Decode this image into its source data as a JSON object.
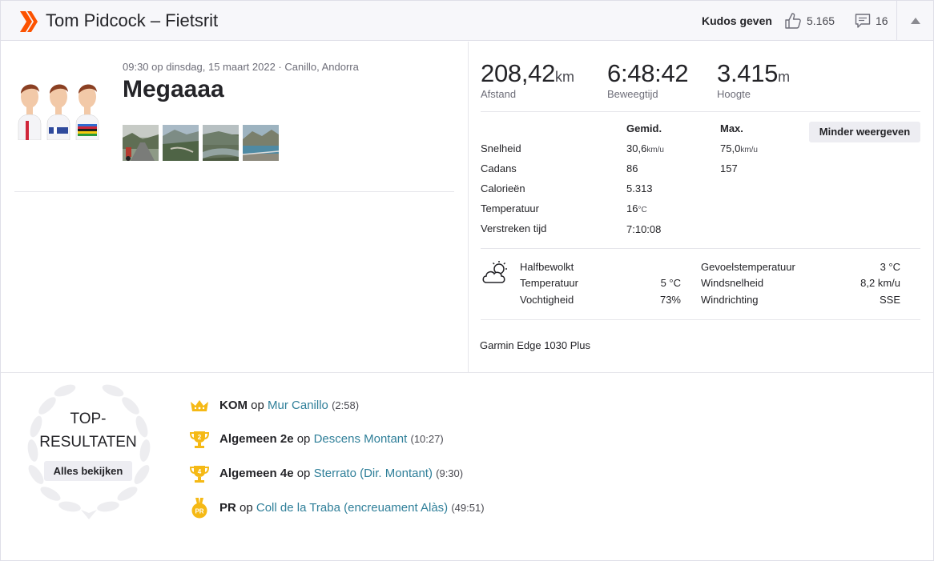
{
  "header": {
    "title": "Tom Pidcock – Fietsrit",
    "kudos_button": "Kudos geven",
    "kudos_count": "5.165",
    "comment_count": "16"
  },
  "activity": {
    "meta": "09:30 op dinsdag, 15 maart 2022 · Canillo, Andorra",
    "title": "Megaaaa"
  },
  "stats": {
    "distance": {
      "value": "208,42",
      "unit": "km",
      "label": "Afstand"
    },
    "moving_time": {
      "value": "6:48:42",
      "label": "Beweegtijd"
    },
    "elevation": {
      "value": "3.415",
      "unit": "m",
      "label": "Hoogte"
    }
  },
  "table": {
    "col_avg": "Gemid.",
    "col_max": "Max.",
    "less_button": "Minder weergeven",
    "rows": [
      {
        "label": "Snelheid",
        "avg": "30,6",
        "avg_unit": "km/u",
        "max": "75,0",
        "max_unit": "km/u"
      },
      {
        "label": "Cadans",
        "avg": "86",
        "avg_unit": "",
        "max": "157",
        "max_unit": ""
      },
      {
        "label": "Calorieën",
        "avg": "5.313",
        "avg_unit": "",
        "max": "",
        "max_unit": ""
      },
      {
        "label": "Temperatuur",
        "avg": "16",
        "avg_unit": "°C",
        "max": "",
        "max_unit": ""
      },
      {
        "label": "Verstreken tijd",
        "avg": "7:10:08",
        "avg_unit": "",
        "max": "",
        "max_unit": ""
      }
    ]
  },
  "weather": {
    "condition": "Halfbewolkt",
    "temp_label": "Temperatuur",
    "temp_value": "5 °C",
    "humidity_label": "Vochtigheid",
    "humidity_value": "73%",
    "feels_label": "Gevoelstemperatuur",
    "feels_value": "3 °C",
    "wind_speed_label": "Windsnelheid",
    "wind_speed_value": "8,2 km/u",
    "wind_dir_label": "Windrichting",
    "wind_dir_value": "SSE"
  },
  "device": "Garmin Edge 1030 Plus",
  "top_results": {
    "title": "TOP-RESULTATEN",
    "see_all": "Alles bekijken",
    "items": [
      {
        "icon": "crown-icon",
        "rank": "KOM",
        "op": "op",
        "segment": "Mur Canillo",
        "time": "(2:58)"
      },
      {
        "icon": "trophy-2-icon",
        "rank": "Algemeen 2e",
        "op": "op",
        "segment": "Descens Montant",
        "time": "(10:27)"
      },
      {
        "icon": "trophy-4-icon",
        "rank": "Algemeen 4e",
        "op": "op",
        "segment": "Sterrato (Dir. Montant)",
        "time": "(9:30)"
      },
      {
        "icon": "pr-medal-icon",
        "rank": "PR",
        "op": "op",
        "segment": "Coll de la Traba (encreuament Alàs)",
        "time": "(49:51)"
      }
    ]
  },
  "colors": {
    "brand": "#fc5200",
    "link": "#2f7f99",
    "gold": "#f5b915"
  }
}
